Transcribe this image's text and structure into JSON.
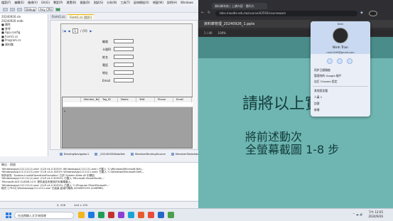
{
  "vs": {
    "menu": [
      "檔案(F)",
      "編輯(E)",
      "檢視(V)",
      "Git(G)",
      "專案(P)",
      "建置(B)",
      "偵錯(D)",
      "測試(S)",
      "分析(N)",
      "工具(T)",
      "延伸模組(X)",
      "視窗(W)",
      "說明(H)",
      "Windows"
    ],
    "toolbar": {
      "config": "Debug",
      "platform": "Any CPU"
    },
    "solution_items": [
      "20240926.sln",
      "20240926.mdb",
      "■ 屬性",
      "■ 參考",
      "■ App.config",
      "■ Form1.cs",
      "■ Program.cs",
      "■ 資料集"
    ],
    "doc_tabs": [
      {
        "label": "Form1.cs",
        "active": false
      },
      {
        "label": "Form1.cs [設計]",
        "active": true
      }
    ],
    "nav": {
      "record": "1",
      "of": "/ {0}"
    },
    "fields": [
      "編號",
      "卡號ID",
      "姓名",
      "電話",
      "地址",
      "Email"
    ],
    "grid_columns": [
      "Member_No",
      "Tag_ID",
      "Name",
      "Tel#",
      "Phone",
      "Email"
    ],
    "tray_items": [
      "BindingNavigator1",
      "_20240926DataSet",
      "MemberBindingSource",
      "MemberTableAdapter"
    ],
    "output_title": "輸出",
    "output_source": "偵錯",
    "output_lines": [
      "'Windowsapp1111111(1).exe' (CLR v4.0.30319: Windowsapp1111111.exe): 已載入 'C:\\Windows\\Microsoft.Net\\...",
      "'WindowsApp1111111(1).exe' (CLR v4.0.30319: WindowsApp1111111.exe): 已載入 'C:\\Windows\\Microsoft.Net\\...",
      "例外狀況: 'System.InvalidOperationException' 已於 System.Data.dll 中擲回",
      "'Windowsapp1111111(1).exe' (CLR v4.0.30319): 已載入 'Microsoft.VisualStudio...'",
      "'Microsoft.ACE.OLEDB.12.0' 提供者並未登錄於本機電腦上。",
      "",
      "'Windowsapp1111111(1).exe' (CLR v4.0.30319): 已載入 'C:\\Program Files\\Microsoft...'",
      "程式 '[7932] Windowsapp1111111.exe' 已結束,結束代碼為 4294967295 (0xffffffff)."
    ],
    "status": {
      "position": "9, 328",
      "size": "444 x 155"
    }
  },
  "chrome": {
    "tab_title": "資料庫系統 | 上課內容 - 雲科大",
    "url": "tdes.moodle.edu.tw/course/42593/courseware",
    "pdf_title": "資料庫管理_20240926_1.pptx",
    "page": "1 / 40",
    "zoom": "100%",
    "slide_line1": "請將以上實",
    "slide_line2a": "將前述動次",
    "slide_line2b": "全螢幕截圖 1-8 步"
  },
  "profile": {
    "label": "Ninh",
    "name": "Ninh Tran",
    "email": "ninh1409@gmail.com",
    "menu": [
      "同步已經開啟",
      "管理你的 Google 帳戶",
      "自訂 Chrome 設定"
    ],
    "other_title": "其他設定檔",
    "others": [
      "人員 1",
      "訪客",
      "新增"
    ]
  },
  "taskbar": {
    "search": "在這裡輸入文字來搜尋",
    "time": "下午 12:05",
    "date": "2024/9/26",
    "icon_colors": [
      "#f2b61c",
      "#1c7be0",
      "#1f9d55",
      "#c3312f",
      "#8a3fd1",
      "#1aa3d8",
      "#e85a2c",
      "#e84c3d",
      "#2468c8",
      "#4aa14a"
    ]
  }
}
